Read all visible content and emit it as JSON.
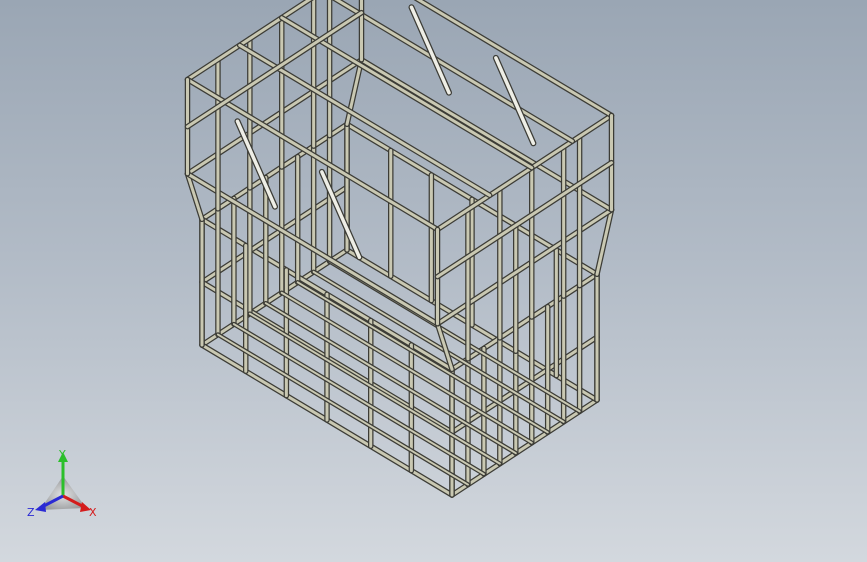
{
  "viewport": {
    "background_top": "#9aa6b4",
    "background_bottom": "#d3d8de"
  },
  "model": {
    "frame_color": "#c9c8b2",
    "frame_edge_color": "#3c3c36",
    "highlight_color": "#eeeee6"
  },
  "triad": {
    "x_label": "X",
    "y_label": "Y",
    "z_label": "Z",
    "x_color": "#d41c1c",
    "y_color": "#2bbf2b",
    "z_color": "#2a2ad4",
    "icon": "view-orientation-triad-icon"
  }
}
